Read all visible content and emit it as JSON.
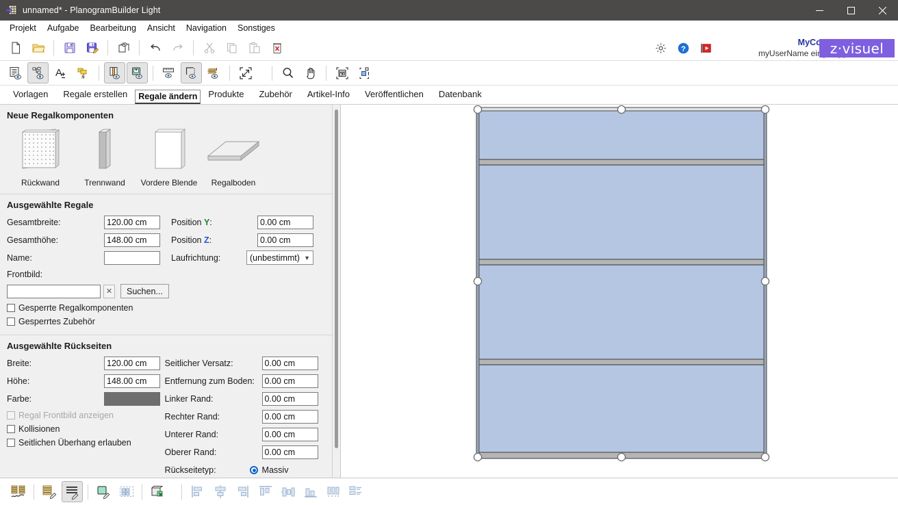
{
  "window": {
    "title": "unnamed* - PlanogramBuilder Light",
    "icon": "planogram-app-icon",
    "controls": {
      "minimize": "minimize",
      "maximize": "maximize",
      "close": "close"
    },
    "titlebar_bg": "#4c4a48"
  },
  "menu": {
    "items": [
      "Projekt",
      "Aufgabe",
      "Bearbeitung",
      "Ansicht",
      "Navigation",
      "Sonstiges"
    ]
  },
  "toolbar_main": {
    "groups": [
      {
        "buttons": [
          {
            "name": "new-file-button",
            "icon": "new-document-icon",
            "label": "Neu",
            "state": "enabled"
          },
          {
            "name": "open-file-button",
            "icon": "open-folder-icon",
            "label": "Öffnen",
            "state": "enabled"
          }
        ]
      },
      {
        "buttons": [
          {
            "name": "save-button",
            "icon": "save-disk-icon",
            "label": "Speichern",
            "state": "enabled"
          },
          {
            "name": "save-as-button",
            "icon": "save-as-disk-pencil-icon",
            "label": "Speichern unter",
            "state": "enabled"
          }
        ]
      },
      {
        "buttons": [
          {
            "name": "project-copy-button",
            "icon": "copy-pages-icon",
            "label": "Projekte",
            "state": "enabled"
          }
        ]
      },
      {
        "buttons": [
          {
            "name": "undo-button",
            "icon": "undo-arrow-icon",
            "label": "Rückgängig",
            "state": "enabled"
          },
          {
            "name": "redo-button",
            "icon": "redo-arrow-icon",
            "label": "Wiederholen",
            "state": "disabled"
          }
        ]
      },
      {
        "buttons": [
          {
            "name": "cut-button",
            "icon": "scissors-icon",
            "label": "Ausschneiden",
            "state": "disabled"
          },
          {
            "name": "copy-button",
            "icon": "copy-icon",
            "label": "Kopieren",
            "state": "disabled"
          },
          {
            "name": "paste-button",
            "icon": "paste-icon",
            "label": "Einfügen",
            "state": "disabled"
          },
          {
            "name": "delete-button",
            "icon": "delete-trash-icon",
            "label": "Löschen",
            "state": "enabled"
          }
        ]
      }
    ]
  },
  "toolbar_view": {
    "buttons": [
      {
        "name": "show-list-button",
        "icon": "list-eye-icon",
        "active": false
      },
      {
        "name": "show-structure-button",
        "icon": "structure-eye-icon",
        "active": true
      },
      {
        "name": "show-text-button",
        "icon": "text-plus-icon",
        "active": false
      },
      {
        "name": "show-colors-button",
        "icon": "colored-layers-icon",
        "active": false
      },
      {
        "name": "show-doors-button",
        "icon": "door-eye-icon",
        "active": true
      },
      {
        "name": "show-products-button",
        "icon": "product-eye-icon",
        "active": true
      },
      {
        "name": "show-ruler-button",
        "icon": "ruler-eye-icon",
        "active": false
      },
      {
        "name": "show-shelf-eye-button",
        "icon": "shelf-corner-eye-icon",
        "active": true
      },
      {
        "name": "show-stack-button",
        "icon": "stack-eye-icon",
        "active": false
      },
      {
        "name": "fit-view-button",
        "icon": "expand-diagonal-icon",
        "active": false
      }
    ]
  },
  "toolbar_nav": {
    "buttons": [
      {
        "name": "zoom-tool-button",
        "icon": "magnifier-icon",
        "active": false
      },
      {
        "name": "pan-tool-button",
        "icon": "hand-icon",
        "active": false
      },
      {
        "name": "zoom-to-scene-button",
        "icon": "zoom-scene-icon",
        "active": false
      },
      {
        "name": "zoom-to-selection-button",
        "icon": "zoom-selection-icon",
        "active": false
      }
    ]
  },
  "account": {
    "company": "MyCompany",
    "status": "myUserName eingeloggt",
    "company_color": "#2433a0",
    "logo_text": "z·visuel",
    "logo_bg": "#7d5fe0",
    "settings_icon": "gear-icon",
    "help_icon": "help-question-icon",
    "video_icon": "video-play-icon"
  },
  "tabs": {
    "items": [
      {
        "label": "Vorlagen",
        "selected": false
      },
      {
        "label": "Regale erstellen",
        "selected": false
      },
      {
        "label": "Regale ändern",
        "selected": true
      },
      {
        "label": "Produkte",
        "selected": false
      },
      {
        "label": "Zubehör",
        "selected": false
      },
      {
        "label": "Artikel-Info",
        "selected": false
      },
      {
        "label": "Veröffentlichen",
        "selected": false
      },
      {
        "label": "Datenbank",
        "selected": false
      }
    ]
  },
  "panel": {
    "components_section": {
      "title": "Neue Regalkomponenten",
      "items": [
        {
          "label": "Rückwand",
          "icon": "pegboard-back-panel-icon"
        },
        {
          "label": "Trennwand",
          "icon": "divider-panel-icon"
        },
        {
          "label": "Vordere Blende",
          "icon": "front-fascia-icon"
        },
        {
          "label": "Regalboden",
          "icon": "shelf-board-icon"
        }
      ]
    },
    "shelves_section": {
      "title": "Ausgewählte Regale",
      "fields": {
        "gesamtbreite_label": "Gesamtbreite:",
        "gesamtbreite_value": "120.00 cm",
        "gesamthoehe_label": "Gesamthöhe:",
        "gesamthoehe_value": "148.00 cm",
        "name_label": "Name:",
        "name_value": "",
        "position_y_label": "Position ",
        "position_y_axis": "Y",
        "position_y_colon": ":",
        "position_y_value": "0.00 cm",
        "position_z_label": "Position ",
        "position_z_axis": "Z",
        "position_z_colon": ":",
        "position_z_value": "0.00 cm",
        "laufrichtung_label": "Laufrichtung:",
        "laufrichtung_value": "(unbestimmt)",
        "frontbild_label": "Frontbild:",
        "frontbild_value": "",
        "frontbild_clear": "✕",
        "frontbild_browse": "Suchen..."
      },
      "checkboxes": [
        {
          "label": "Gesperrte Regalkomponenten",
          "checked": false,
          "disabled": false
        },
        {
          "label": "Gesperrtes Zubehör",
          "checked": false,
          "disabled": false
        }
      ],
      "axis_colors": {
        "y": "#178a2c",
        "z": "#2a55d6"
      }
    },
    "backpanels_section": {
      "title": "Ausgewählte Rückseiten",
      "left_fields": [
        {
          "label": "Breite:",
          "value": "120.00 cm",
          "name": "breite-field"
        },
        {
          "label": "Höhe:",
          "value": "148.00 cm",
          "name": "hoehe-field"
        }
      ],
      "color_label": "Farbe:",
      "color_value": "#6e6e6e",
      "checkboxes": [
        {
          "label": "Regal Frontbild anzeigen",
          "checked": false,
          "disabled": true
        },
        {
          "label": "Kollisionen",
          "checked": false,
          "disabled": false
        },
        {
          "label": "Seitlichen Überhang erlauben",
          "checked": false,
          "disabled": false
        }
      ],
      "right_fields": [
        {
          "label": "Seitlicher Versatz:",
          "value": "0.00 cm",
          "name": "seitlicher-versatz-field"
        },
        {
          "label": "Entfernung zum Boden:",
          "value": "0.00 cm",
          "name": "entfernung-zum-boden-field"
        },
        {
          "label": "Linker Rand:",
          "value": "0.00 cm",
          "name": "linker-rand-field"
        },
        {
          "label": "Rechter Rand:",
          "value": "0.00 cm",
          "name": "rechter-rand-field"
        },
        {
          "label": "Unterer Rand:",
          "value": "0.00 cm",
          "name": "unterer-rand-field"
        },
        {
          "label": "Oberer Rand:",
          "value": "0.00 cm",
          "name": "oberer-rand-field"
        }
      ],
      "rueckseitetyp_label": "Rückseitetyp:",
      "rueckseitetyp_option": "Massiv",
      "rueckseitetyp_selected": true
    },
    "scrollbar": {
      "name": "panel-scrollbar"
    }
  },
  "viewport": {
    "name": "3d-viewport",
    "background": "#ffffff",
    "shelf": {
      "fill": "#b4c6e2",
      "board_fill": "#b5b5b5",
      "outline": "#4a4a4a",
      "selected": true,
      "handle_fill": "#ffffff",
      "handle_stroke": "#6d6d6d",
      "compartments": 4
    }
  },
  "bottombar": {
    "buttons": [
      {
        "name": "select-shelves-path-button",
        "icon": "shelves-wave-icon",
        "active": false,
        "disabled": false
      },
      {
        "name": "edit-shelf-unit-button",
        "icon": "shelves-pencil-icon",
        "active": false,
        "disabled": false
      },
      {
        "name": "edit-shelf-rows-button",
        "icon": "lines-pencil-icon",
        "active": true,
        "disabled": false
      },
      {
        "name": "edit-product-button",
        "icon": "product-pencil-icon",
        "active": false,
        "disabled": false
      },
      {
        "name": "select-products-button",
        "icon": "products-dashed-icon",
        "active": false,
        "disabled": true
      },
      {
        "name": "move-into-button",
        "icon": "move-into-arrow-icon",
        "active": false,
        "disabled": false
      },
      {
        "name": "align-left-button",
        "icon": "align-left-icon",
        "active": false,
        "disabled": true
      },
      {
        "name": "align-center-vertical-button",
        "icon": "align-center-vertical-icon",
        "active": false,
        "disabled": true
      },
      {
        "name": "align-right-button",
        "icon": "align-right-icon",
        "active": false,
        "disabled": true
      },
      {
        "name": "align-top-button",
        "icon": "align-top-icon",
        "active": false,
        "disabled": true
      },
      {
        "name": "align-middle-horizontal-button",
        "icon": "align-middle-horizontal-icon",
        "active": false,
        "disabled": true
      },
      {
        "name": "align-bottom-button",
        "icon": "align-bottom-icon",
        "active": false,
        "disabled": true
      },
      {
        "name": "distribute-horizontal-button",
        "icon": "distribute-horizontal-icon",
        "active": false,
        "disabled": true
      },
      {
        "name": "distribute-list-button",
        "icon": "distribute-list-icon",
        "active": false,
        "disabled": true
      }
    ]
  }
}
